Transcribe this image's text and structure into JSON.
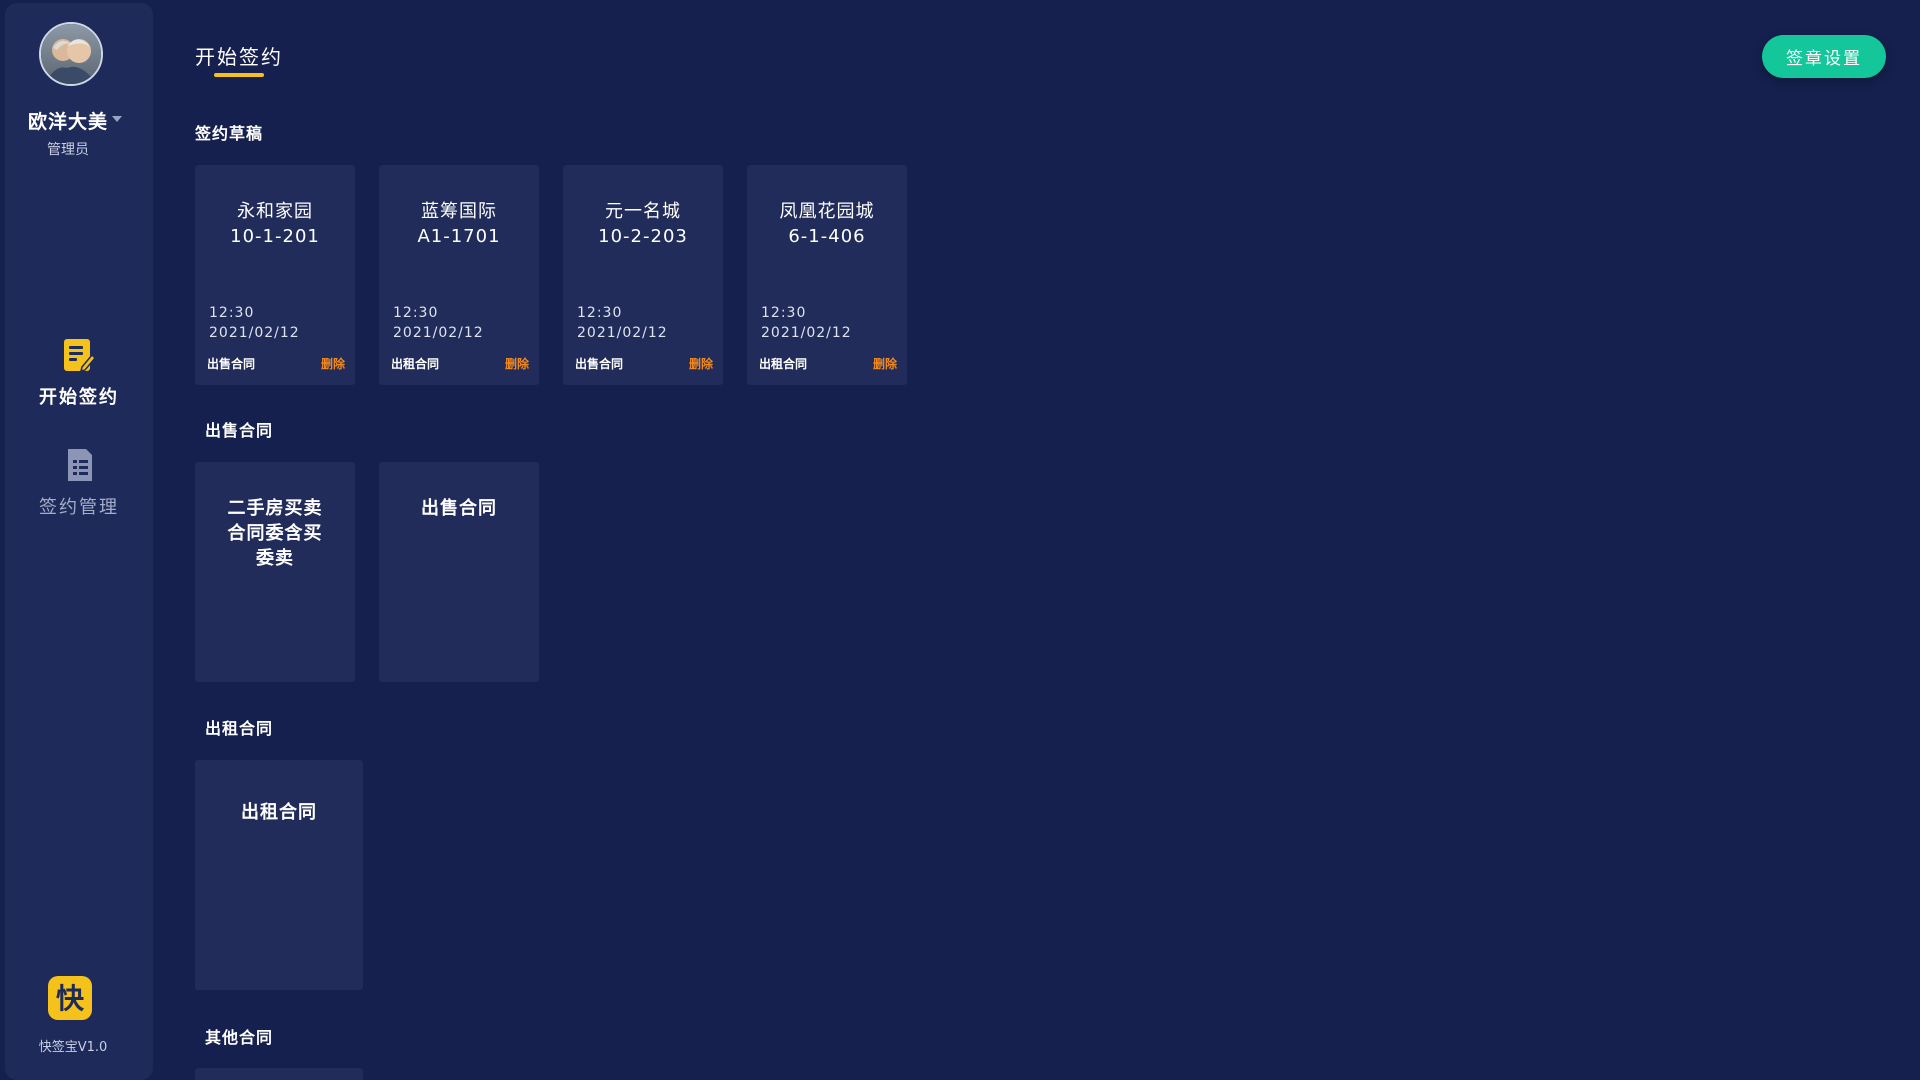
{
  "user": {
    "name": "欧洋大美",
    "role": "管理员"
  },
  "nav": {
    "items": [
      {
        "label": "开始签约",
        "icon": "contract-edit-icon",
        "active": true,
        "color": "#f4c21b"
      },
      {
        "label": "签约管理",
        "icon": "document-list-icon",
        "active": false,
        "color": "#8c95b5"
      }
    ]
  },
  "app": {
    "logo_char": "快",
    "version": "快签宝V1.0"
  },
  "header": {
    "title": "开始签约",
    "seal_settings_label": "签章设置"
  },
  "drafts": {
    "title": "签约草稿",
    "items": [
      {
        "name_line1": "永和家园",
        "name_line2": "10-1-201",
        "time": "12:30",
        "date": "2021/02/12",
        "type": "出售合同",
        "delete_label": "删除"
      },
      {
        "name_line1": "蓝筹国际",
        "name_line2": "A1-1701",
        "time": "12:30",
        "date": "2021/02/12",
        "type": "出租合同",
        "delete_label": "删除"
      },
      {
        "name_line1": "元一名城",
        "name_line2": "10-2-203",
        "time": "12:30",
        "date": "2021/02/12",
        "type": "出售合同",
        "delete_label": "删除"
      },
      {
        "name_line1": "凤凰花园城",
        "name_line2": "6-1-406",
        "time": "12:30",
        "date": "2021/02/12",
        "type": "出租合同",
        "delete_label": "删除"
      }
    ]
  },
  "sale_contracts": {
    "title": "出售合同",
    "items": [
      {
        "line1": "二手房买卖",
        "line2": "合同委含买",
        "line3": "委卖"
      },
      {
        "line1": "出售合同"
      }
    ]
  },
  "rent_contracts": {
    "title": "出租合同",
    "items": [
      {
        "line1": "出租合同"
      }
    ]
  },
  "other_contracts": {
    "title": "其他合同"
  },
  "colors": {
    "background": "#16204e",
    "sidebar": "#1e2a59",
    "card": "#212c5a",
    "accent_yellow": "#f4c21b",
    "accent_green": "#13c79b",
    "delete_orange": "#f28a1e"
  }
}
